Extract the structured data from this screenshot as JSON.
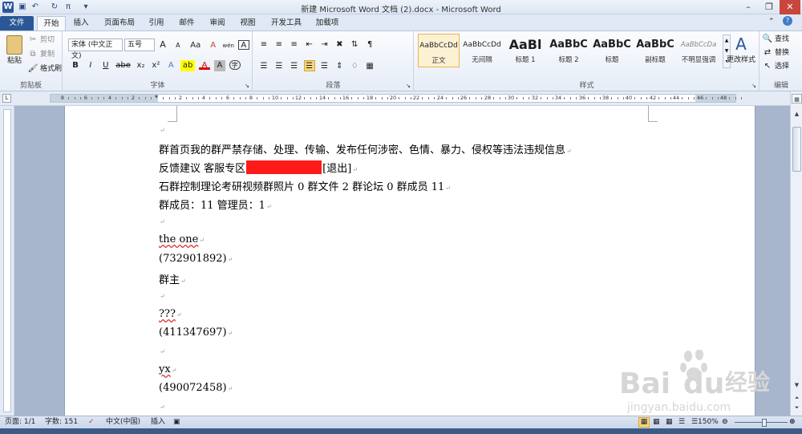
{
  "window": {
    "title": "新建 Microsoft Word 文档 (2).docx - Microsoft Word",
    "quick_access": [
      "W",
      "save",
      "undo",
      "redo",
      "π"
    ]
  },
  "tabs": [
    {
      "label": "文件"
    },
    {
      "label": "开始"
    },
    {
      "label": "插入"
    },
    {
      "label": "页面布局"
    },
    {
      "label": "引用"
    },
    {
      "label": "邮件"
    },
    {
      "label": "审阅"
    },
    {
      "label": "视图"
    },
    {
      "label": "开发工具"
    },
    {
      "label": "加载项"
    }
  ],
  "ribbon": {
    "clipboard": {
      "paste": "粘贴",
      "cut": "剪切",
      "copy": "复制",
      "format_painter": "格式刷",
      "label": "剪贴板"
    },
    "font": {
      "family": "宋体 (中文正文)",
      "size": "五号",
      "label": "字体",
      "grow": "A",
      "shrink": "A",
      "change_case": "Aa",
      "clear": "A",
      "phonetic": "wén",
      "border_char": "A",
      "bold": "B",
      "italic": "I",
      "underline": "U",
      "strike": "abe",
      "sub": "x₂",
      "sup": "x²",
      "effects": "A",
      "highlight": "ab",
      "color": "A",
      "char_shade": "A",
      "enclose": "字"
    },
    "paragraph": {
      "label": "段落"
    },
    "styles": {
      "label": "样式",
      "items": [
        {
          "preview": "AaBbCcDd",
          "name": "正文"
        },
        {
          "preview": "AaBbCcDd",
          "name": "无间隔"
        },
        {
          "preview": "AaBl",
          "name": "标题 1"
        },
        {
          "preview": "AaBbC",
          "name": "标题 2"
        },
        {
          "preview": "AaBbC",
          "name": "标题"
        },
        {
          "preview": "AaBbC",
          "name": "副标题"
        },
        {
          "preview": "AaBbCcDa",
          "name": "不明显强调"
        }
      ],
      "change": "更改样式"
    },
    "editing": {
      "find": "查找",
      "replace": "替换",
      "select": "选择",
      "label": "编辑"
    }
  },
  "ruler": {
    "ticks": [
      "8",
      "6",
      "4",
      "2",
      "",
      "2",
      "4",
      "6",
      "8",
      "10",
      "12",
      "14",
      "16",
      "18",
      "20",
      "22",
      "24",
      "26",
      "28",
      "30",
      "32",
      "34",
      "36",
      "38",
      "40",
      "42",
      "44",
      "46",
      "48"
    ]
  },
  "document": {
    "lines": [
      {
        "text": "",
        "mark": "↵"
      },
      {
        "text": "群首页我的群严禁存储、处理、传输、发布任何涉密、色情、暴力、侵权等违法违规信息",
        "mark": "↵"
      },
      {
        "prefix": "反馈建议  客服专区",
        "suffix": "[退出]",
        "mark": "↵"
      },
      {
        "text": "石群控制理论考研视频群照片 0 群文件 2 群论坛 0 群成员 11",
        "mark": "↵"
      },
      {
        "text": "群成员：11 管理员：1",
        "mark": "↵"
      },
      {
        "text": "",
        "mark": "↵"
      },
      {
        "text": "the one",
        "mark": "↵"
      },
      {
        "text": "(732901892)",
        "mark": "↵"
      },
      {
        "text": "群主",
        "mark": "↵"
      },
      {
        "text": "",
        "mark": "↵"
      },
      {
        "text": "???",
        "mark": "↵"
      },
      {
        "text": "(411347697)",
        "mark": "↵"
      },
      {
        "text": "",
        "mark": "↵"
      },
      {
        "text": "yx",
        "mark": "↵"
      },
      {
        "text": "(490072458)",
        "mark": "↵"
      },
      {
        "text": "",
        "mark": "↵"
      }
    ]
  },
  "status": {
    "page": "页面: 1/1",
    "words": "字数: 151",
    "lang": "中文(中国)",
    "mode": "插入",
    "zoom": "150%"
  },
  "watermark": {
    "brand": "Bai",
    "brand2": "du",
    "suffix": "经验",
    "url": "jingyan.baidu.com"
  }
}
